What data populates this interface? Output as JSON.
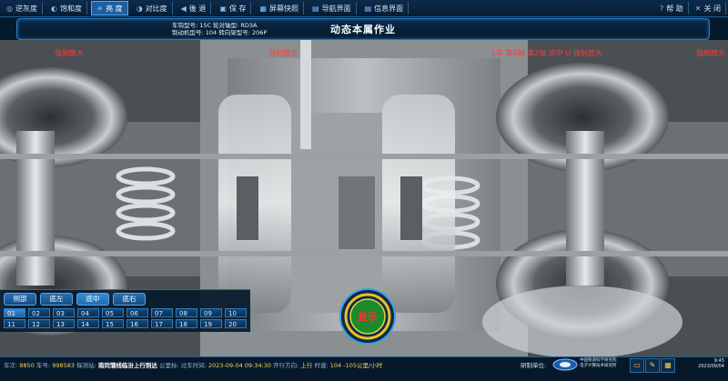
{
  "toolbar": {
    "items": [
      {
        "label": "逆灰度",
        "icon": "◎"
      },
      {
        "label": "饱和度",
        "icon": "◐"
      },
      {
        "label": "亮 度",
        "icon": "☀"
      },
      {
        "label": "对比度",
        "icon": "◑"
      },
      {
        "label": "後 退",
        "icon": "◀"
      },
      {
        "label": "保 存",
        "icon": "▣"
      },
      {
        "label": "屏幕快照",
        "icon": "▦"
      },
      {
        "label": "导航界面",
        "icon": "▤"
      },
      {
        "label": "信息界面",
        "icon": "▤"
      },
      {
        "label": "帮 助",
        "icon": "?"
      },
      {
        "label": "关 闭",
        "icon": "✕"
      }
    ]
  },
  "header": {
    "line1": "车钩型号: 15C  轮对轴型: RD3A",
    "line2": "制动机型号: 104  转向架型号: 206P",
    "title": "动态本属作业"
  },
  "viewer": {
    "tags": [
      "强制放大",
      "强制放大",
      "1车 第4轴 第2轴 底中 U 强制放大",
      "强制放大"
    ]
  },
  "positions": {
    "items": [
      "侧部",
      "底左",
      "底中",
      "底右"
    ],
    "active": 2
  },
  "grid": {
    "cells": [
      "01",
      "02",
      "03",
      "04",
      "05",
      "06",
      "07",
      "08",
      "09",
      "10",
      "11",
      "12",
      "13",
      "14",
      "15",
      "16",
      "17",
      "18",
      "19",
      "20"
    ],
    "selected": 0
  },
  "confirm_button": {
    "label": "复示"
  },
  "status": {
    "car_no_label": "车次:",
    "car_no": "8850",
    "vehicle_label": "车号:",
    "vehicle": "998583",
    "station_label": "探测站:",
    "station": "南同蒲线临汾上行到达",
    "km_label": "公里标:",
    "time_label": "过车时间:",
    "time": "2023-09-04 09:34:30",
    "direction_label": "开行方向:",
    "direction": "上行",
    "speed_label": "时速:",
    "speed": "104 -105公里/小时",
    "unit_label": "研制单位:",
    "org_line1": "中国铁道科学研究院",
    "org_line2": "电子计算技术研究所",
    "clock_time": "9:45",
    "clock_date": "2023/09/04"
  }
}
